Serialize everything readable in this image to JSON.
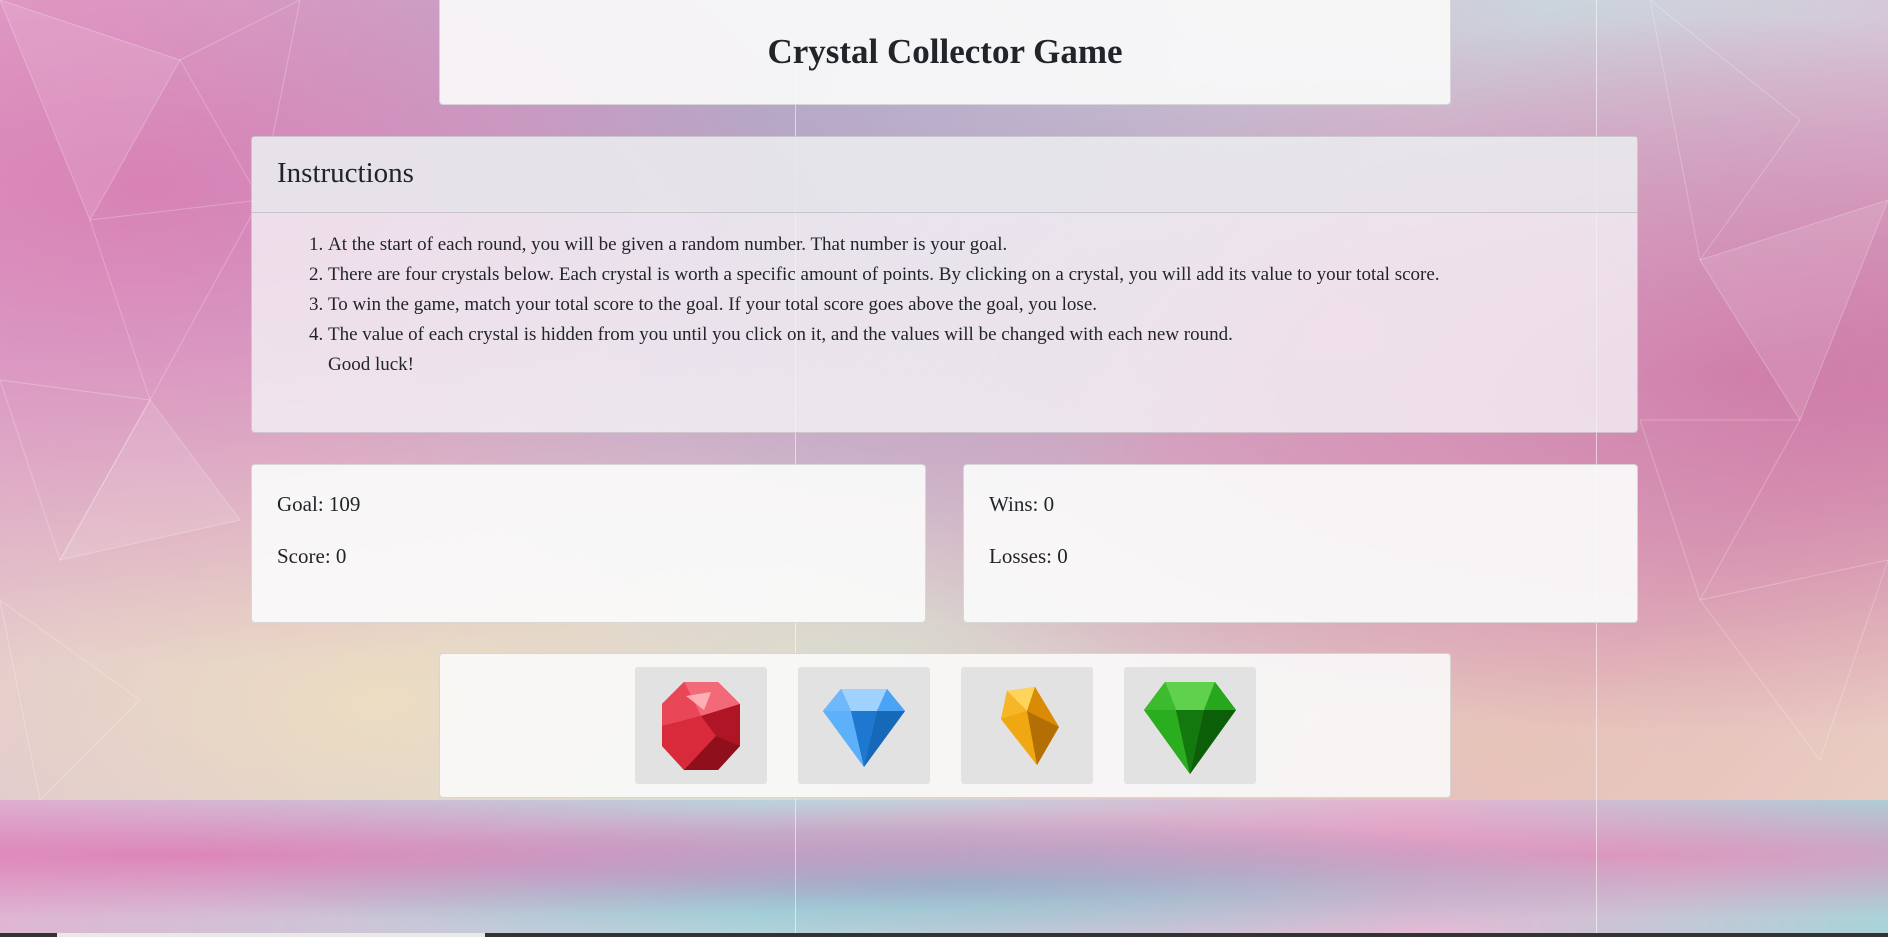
{
  "header": {
    "title": "Crystal Collector Game"
  },
  "instructions": {
    "heading": "Instructions",
    "items": [
      "At the start of each round, you will be given a random number. That number is your goal.",
      "There are four crystals below. Each crystal is worth a specific amount of points. By clicking on a crystal, you will add its value to your total score.",
      "To win the game, match your total score to the goal. If your total score goes above the goal, you lose.",
      "The value of each crystal is hidden from you until you click on it, and the values will be changed with each new round."
    ],
    "closing": "Good luck!"
  },
  "stats": {
    "goal": "Goal: 109",
    "score": "Score: 0",
    "wins": "Wins: 0",
    "losses": "Losses: 0"
  },
  "crystals": [
    {
      "icon": "red-crystal-icon",
      "color": "#d9283a"
    },
    {
      "icon": "blue-crystal-icon",
      "color": "#3a9ef0"
    },
    {
      "icon": "yellow-crystal-icon",
      "color": "#e8a20c"
    },
    {
      "icon": "green-crystal-icon",
      "color": "#1a9c12"
    }
  ]
}
